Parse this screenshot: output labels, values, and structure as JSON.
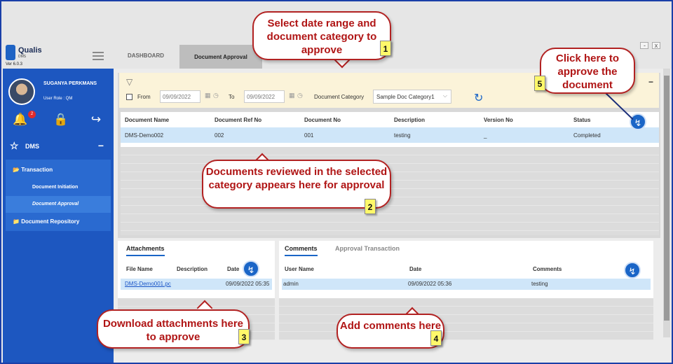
{
  "app": {
    "name": "Qualis",
    "sub": "DMS",
    "version": "Ver 6.0.3"
  },
  "tabs": [
    {
      "label": "DASHBOARD"
    },
    {
      "label": "Document Approval"
    }
  ],
  "window_controls": {
    "close": "x",
    "minimize": "-"
  },
  "user": {
    "name": "SUGANYA PERKMANS",
    "role": "User Role : QM",
    "notifications": "2"
  },
  "sidebar": {
    "module": "DMS",
    "transaction": "Transaction",
    "items": [
      "Document Initiation",
      "Document Approval"
    ],
    "repository": "Document Repository"
  },
  "filter": {
    "from_label": "From",
    "from_value": "09/09/2022",
    "to_label": "To",
    "to_value": "09/09/2022",
    "category_label": "Document Category",
    "category_value": "Sample Doc Category1"
  },
  "grid": {
    "headers": [
      "Document Name",
      "Document Ref No",
      "Document No",
      "Description",
      "Version No",
      "Status"
    ],
    "rows": [
      {
        "name": "DMS-Demo002",
        "ref": "002",
        "no": "001",
        "desc": "testing",
        "ver": "_",
        "status": "Completed"
      }
    ]
  },
  "attachments": {
    "tab": "Attachments",
    "headers": [
      "File Name",
      "Description",
      "Date"
    ],
    "row": {
      "file": "DMS-Demo001.pc",
      "desc": "",
      "date": "09/09/2022 05:35"
    }
  },
  "comments": {
    "tabs": [
      "Comments",
      "Approval Transaction"
    ],
    "headers": [
      "User Name",
      "Date",
      "Comments"
    ],
    "row": {
      "user": "admin",
      "date": "09/09/2022 05:36",
      "comment": "testing"
    }
  },
  "callouts": [
    {
      "text": "Select date range and document category to approve",
      "num": "1"
    },
    {
      "text": "Documents reviewed in the selected category appears here for approval",
      "num": "2"
    },
    {
      "text": "Download attachments here to approve",
      "num": "3"
    },
    {
      "text": "Add comments here",
      "num": "4"
    },
    {
      "text": "Click here to approve the document",
      "num": "5"
    }
  ],
  "colors": {
    "accent": "#1a65c7",
    "sidebar": "#1d57c0",
    "callout": "#b01515",
    "filter_bg": "#fbf3d9"
  }
}
